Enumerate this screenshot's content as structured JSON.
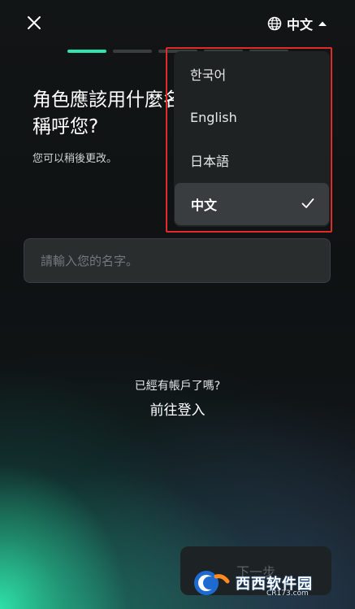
{
  "header": {
    "close_icon": "close-icon",
    "language_icon": "globe-icon",
    "language_label": "中文",
    "dropdown_icon": "caret-up-icon"
  },
  "progress": {
    "total_steps": 5,
    "current_step": 1,
    "active_color": "#2ee4b1"
  },
  "main": {
    "title": "角色應該用什麼名\n稱呼您?",
    "subtitle": "您可以稍後更改。",
    "name_input": {
      "value": "",
      "placeholder": "請輸入您的名字。"
    },
    "have_account_text": "已經有帳戶了嗎?",
    "login_link": "前往登入",
    "next_button": "下一步"
  },
  "language_menu": {
    "items": [
      {
        "label": "한국어",
        "selected": false
      },
      {
        "label": "English",
        "selected": false
      },
      {
        "label": "日本語",
        "selected": false
      },
      {
        "label": "中文",
        "selected": true
      }
    ],
    "check_icon": "check-icon",
    "highlight_color": "#e02b2b"
  },
  "watermark": {
    "brand": "西西软件园",
    "site": "CR173.com",
    "logo_letter": "Cr"
  }
}
